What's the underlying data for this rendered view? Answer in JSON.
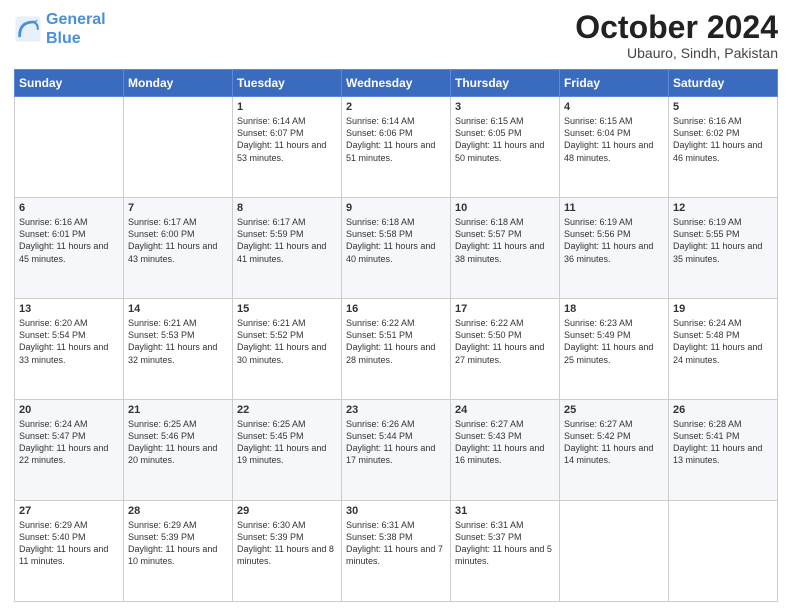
{
  "header": {
    "logo_line1": "General",
    "logo_line2": "Blue",
    "month": "October 2024",
    "location": "Ubauro, Sindh, Pakistan"
  },
  "weekdays": [
    "Sunday",
    "Monday",
    "Tuesday",
    "Wednesday",
    "Thursday",
    "Friday",
    "Saturday"
  ],
  "weeks": [
    [
      {
        "day": "",
        "info": ""
      },
      {
        "day": "",
        "info": ""
      },
      {
        "day": "1",
        "info": "Sunrise: 6:14 AM\nSunset: 6:07 PM\nDaylight: 11 hours and 53 minutes."
      },
      {
        "day": "2",
        "info": "Sunrise: 6:14 AM\nSunset: 6:06 PM\nDaylight: 11 hours and 51 minutes."
      },
      {
        "day": "3",
        "info": "Sunrise: 6:15 AM\nSunset: 6:05 PM\nDaylight: 11 hours and 50 minutes."
      },
      {
        "day": "4",
        "info": "Sunrise: 6:15 AM\nSunset: 6:04 PM\nDaylight: 11 hours and 48 minutes."
      },
      {
        "day": "5",
        "info": "Sunrise: 6:16 AM\nSunset: 6:02 PM\nDaylight: 11 hours and 46 minutes."
      }
    ],
    [
      {
        "day": "6",
        "info": "Sunrise: 6:16 AM\nSunset: 6:01 PM\nDaylight: 11 hours and 45 minutes."
      },
      {
        "day": "7",
        "info": "Sunrise: 6:17 AM\nSunset: 6:00 PM\nDaylight: 11 hours and 43 minutes."
      },
      {
        "day": "8",
        "info": "Sunrise: 6:17 AM\nSunset: 5:59 PM\nDaylight: 11 hours and 41 minutes."
      },
      {
        "day": "9",
        "info": "Sunrise: 6:18 AM\nSunset: 5:58 PM\nDaylight: 11 hours and 40 minutes."
      },
      {
        "day": "10",
        "info": "Sunrise: 6:18 AM\nSunset: 5:57 PM\nDaylight: 11 hours and 38 minutes."
      },
      {
        "day": "11",
        "info": "Sunrise: 6:19 AM\nSunset: 5:56 PM\nDaylight: 11 hours and 36 minutes."
      },
      {
        "day": "12",
        "info": "Sunrise: 6:19 AM\nSunset: 5:55 PM\nDaylight: 11 hours and 35 minutes."
      }
    ],
    [
      {
        "day": "13",
        "info": "Sunrise: 6:20 AM\nSunset: 5:54 PM\nDaylight: 11 hours and 33 minutes."
      },
      {
        "day": "14",
        "info": "Sunrise: 6:21 AM\nSunset: 5:53 PM\nDaylight: 11 hours and 32 minutes."
      },
      {
        "day": "15",
        "info": "Sunrise: 6:21 AM\nSunset: 5:52 PM\nDaylight: 11 hours and 30 minutes."
      },
      {
        "day": "16",
        "info": "Sunrise: 6:22 AM\nSunset: 5:51 PM\nDaylight: 11 hours and 28 minutes."
      },
      {
        "day": "17",
        "info": "Sunrise: 6:22 AM\nSunset: 5:50 PM\nDaylight: 11 hours and 27 minutes."
      },
      {
        "day": "18",
        "info": "Sunrise: 6:23 AM\nSunset: 5:49 PM\nDaylight: 11 hours and 25 minutes."
      },
      {
        "day": "19",
        "info": "Sunrise: 6:24 AM\nSunset: 5:48 PM\nDaylight: 11 hours and 24 minutes."
      }
    ],
    [
      {
        "day": "20",
        "info": "Sunrise: 6:24 AM\nSunset: 5:47 PM\nDaylight: 11 hours and 22 minutes."
      },
      {
        "day": "21",
        "info": "Sunrise: 6:25 AM\nSunset: 5:46 PM\nDaylight: 11 hours and 20 minutes."
      },
      {
        "day": "22",
        "info": "Sunrise: 6:25 AM\nSunset: 5:45 PM\nDaylight: 11 hours and 19 minutes."
      },
      {
        "day": "23",
        "info": "Sunrise: 6:26 AM\nSunset: 5:44 PM\nDaylight: 11 hours and 17 minutes."
      },
      {
        "day": "24",
        "info": "Sunrise: 6:27 AM\nSunset: 5:43 PM\nDaylight: 11 hours and 16 minutes."
      },
      {
        "day": "25",
        "info": "Sunrise: 6:27 AM\nSunset: 5:42 PM\nDaylight: 11 hours and 14 minutes."
      },
      {
        "day": "26",
        "info": "Sunrise: 6:28 AM\nSunset: 5:41 PM\nDaylight: 11 hours and 13 minutes."
      }
    ],
    [
      {
        "day": "27",
        "info": "Sunrise: 6:29 AM\nSunset: 5:40 PM\nDaylight: 11 hours and 11 minutes."
      },
      {
        "day": "28",
        "info": "Sunrise: 6:29 AM\nSunset: 5:39 PM\nDaylight: 11 hours and 10 minutes."
      },
      {
        "day": "29",
        "info": "Sunrise: 6:30 AM\nSunset: 5:39 PM\nDaylight: 11 hours and 8 minutes."
      },
      {
        "day": "30",
        "info": "Sunrise: 6:31 AM\nSunset: 5:38 PM\nDaylight: 11 hours and 7 minutes."
      },
      {
        "day": "31",
        "info": "Sunrise: 6:31 AM\nSunset: 5:37 PM\nDaylight: 11 hours and 5 minutes."
      },
      {
        "day": "",
        "info": ""
      },
      {
        "day": "",
        "info": ""
      }
    ]
  ]
}
